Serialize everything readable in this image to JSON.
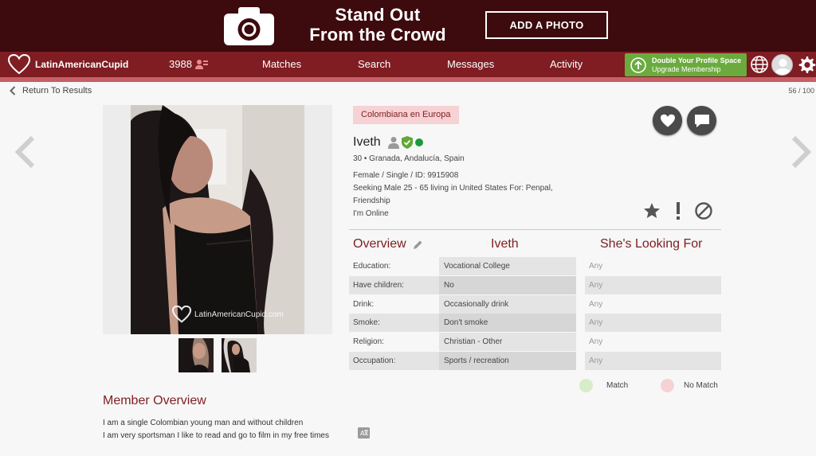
{
  "banner": {
    "headline_line1": "Stand Out",
    "headline_line2": "From the Crowd",
    "cta": "ADD A PHOTO"
  },
  "nav": {
    "logo": "LatinAmericanCupid",
    "notifications_count": "3988",
    "links": [
      "Matches",
      "Search",
      "Messages",
      "Activity"
    ],
    "upgrade_line1": "Double Your Profile Space",
    "upgrade_line2": "Upgrade Membership"
  },
  "subheader": {
    "back_label": "Return To Results",
    "result_count": "56 / 100"
  },
  "photo": {
    "watermark": "LatinAmericanCupid.com"
  },
  "profile": {
    "tag": "Colombiana en Europa",
    "name": "Iveth",
    "location": "30 • Granada, Andalucía, Spain",
    "details": "Female / Single / ID: 9915908",
    "seeking_line1": "Seeking Male 25 - 65 living in United States For: Penpal,",
    "seeking_line2": "Friendship",
    "status": "I'm Online"
  },
  "table": {
    "headers": [
      "Overview",
      "Iveth",
      "She's Looking For"
    ],
    "rows": [
      {
        "label": "Education:",
        "value": "Vocational College",
        "looking": "Any"
      },
      {
        "label": "Have children:",
        "value": "No",
        "looking": "Any"
      },
      {
        "label": "Drink:",
        "value": "Occasionally drink",
        "looking": "Any"
      },
      {
        "label": "Smoke:",
        "value": "Don't smoke",
        "looking": "Any"
      },
      {
        "label": "Religion:",
        "value": "Christian - Other",
        "looking": "Any"
      },
      {
        "label": "Occupation:",
        "value": "Sports / recreation",
        "looking": "Any"
      }
    ]
  },
  "legend": {
    "match": "Match",
    "no_match": "No Match",
    "match_color": "#d7ecc9",
    "no_match_color": "#f6d2d4"
  },
  "member_overview": {
    "title": "Member Overview",
    "line1": "I am a single Colombian young man and without children",
    "line2": "I am very sportsman I like to read and go to film in my free times"
  },
  "colors": {
    "brand": "#7f1d22",
    "banner": "#3d0a0e",
    "upgrade": "#6bab3e",
    "online": "#1a9a3a"
  }
}
